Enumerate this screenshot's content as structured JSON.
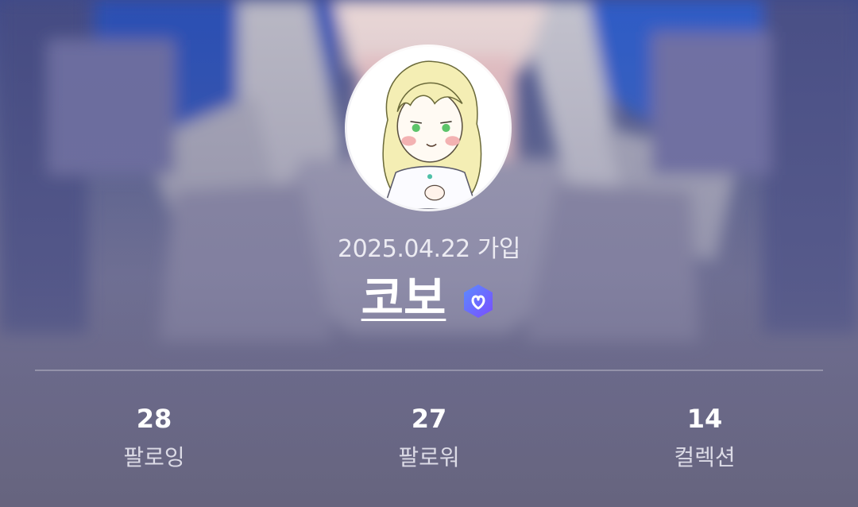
{
  "profile": {
    "join_date": "2025.04.22 가입",
    "username": "코보",
    "verified": true
  },
  "stats": [
    {
      "value": "28",
      "label": "팔로잉"
    },
    {
      "value": "27",
      "label": "팔로워"
    },
    {
      "value": "14",
      "label": "컬렉션"
    }
  ],
  "colors": {
    "badge_gradient_start": "#5b8cff",
    "badge_gradient_end": "#7a4dff",
    "text_primary": "#ffffff",
    "text_secondary": "#dcdbe6"
  }
}
